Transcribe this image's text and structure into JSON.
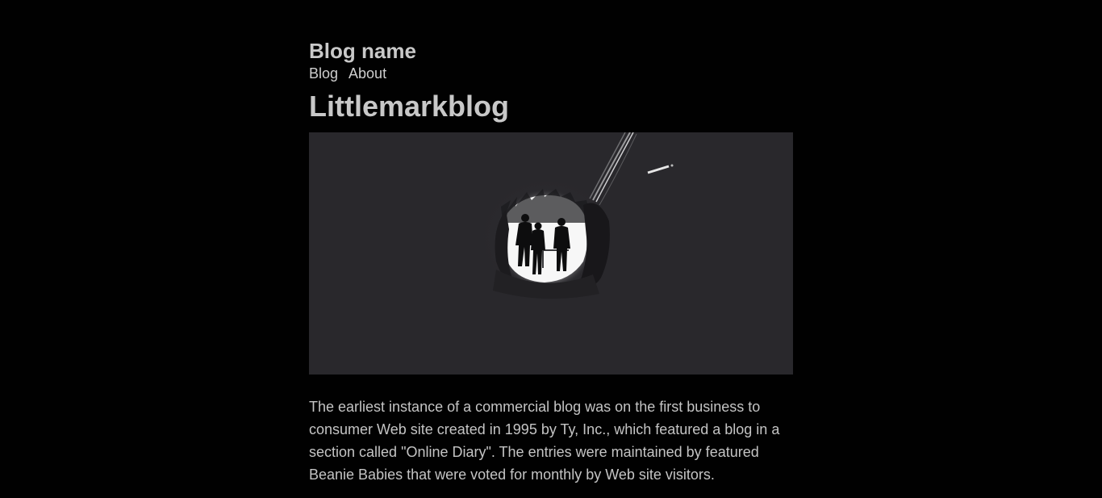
{
  "site": {
    "name": "Blog name"
  },
  "nav": {
    "items": [
      {
        "label": "Blog"
      },
      {
        "label": "About"
      }
    ]
  },
  "post": {
    "title": "Littlemarkblog",
    "image": {
      "subject": "silhouettes of three people at the bright mouth of a dark tunnel"
    },
    "body": "The earliest instance of a commercial blog was on the first business to consumer Web site created in 1995 by Ty, Inc., which featured a blog in a section called \"Online Diary\". The entries were maintained by featured Beanie Babies that were voted for monthly by Web site visitors."
  },
  "colors": {
    "page_background": "#010101",
    "image_background": "#29282c",
    "text": "#c8c8c8"
  }
}
